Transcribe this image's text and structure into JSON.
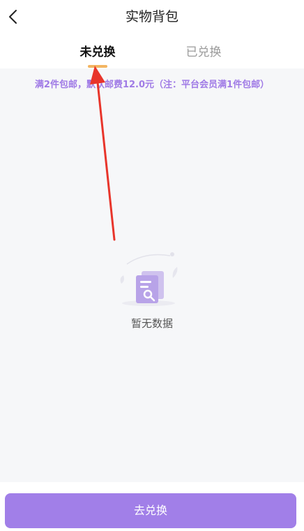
{
  "header": {
    "title": "实物背包",
    "back_icon": "chevron-left-icon"
  },
  "tabs": [
    {
      "label": "未兑换",
      "active": true
    },
    {
      "label": "已兑换",
      "active": false
    }
  ],
  "notice": "满2件包邮，默认邮费12.0元（注：平台会员满1件包邮）",
  "empty_state": {
    "text": "暂无数据",
    "icon": "empty-document-search-icon"
  },
  "footer": {
    "button_label": "去兑换"
  },
  "colors": {
    "accent": "#a17fe8",
    "tab_indicator": "#f3b562",
    "notice_text": "#a07be6",
    "annotation_arrow": "#e8352b"
  }
}
